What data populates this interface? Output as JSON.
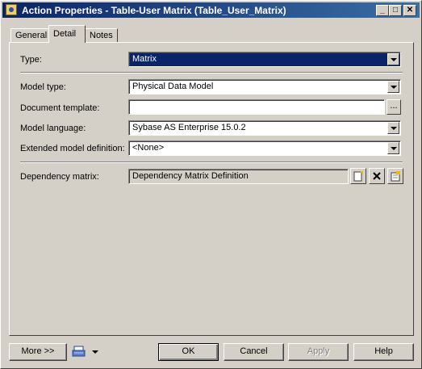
{
  "window": {
    "title": "Action Properties - Table-User Matrix (Table_User_Matrix)",
    "controls": {
      "minimize": "_",
      "maximize": "□",
      "close": "✕"
    }
  },
  "tabs": [
    {
      "label": "General"
    },
    {
      "label": "Detail"
    },
    {
      "label": "Notes"
    }
  ],
  "form": {
    "type": {
      "label": "Type:",
      "value": "Matrix"
    },
    "model_type": {
      "label": "Model type:",
      "value": "Physical Data Model"
    },
    "document_template": {
      "label": "Document template:",
      "value": "",
      "browse": "..."
    },
    "model_language": {
      "label": "Model language:",
      "value": "Sybase AS Enterprise 15.0.2"
    },
    "extended_model_definition": {
      "label": "Extended model definition:",
      "value": "<None>"
    },
    "dependency_matrix": {
      "label": "Dependency matrix:",
      "value": "Dependency Matrix Definition"
    }
  },
  "buttons": {
    "more": "More >>",
    "ok": "OK",
    "cancel": "Cancel",
    "apply": "Apply",
    "help": "Help"
  },
  "icons": {
    "new": "new-document-icon",
    "delete": "delete-icon",
    "properties": "properties-icon",
    "print": "print-icon"
  }
}
